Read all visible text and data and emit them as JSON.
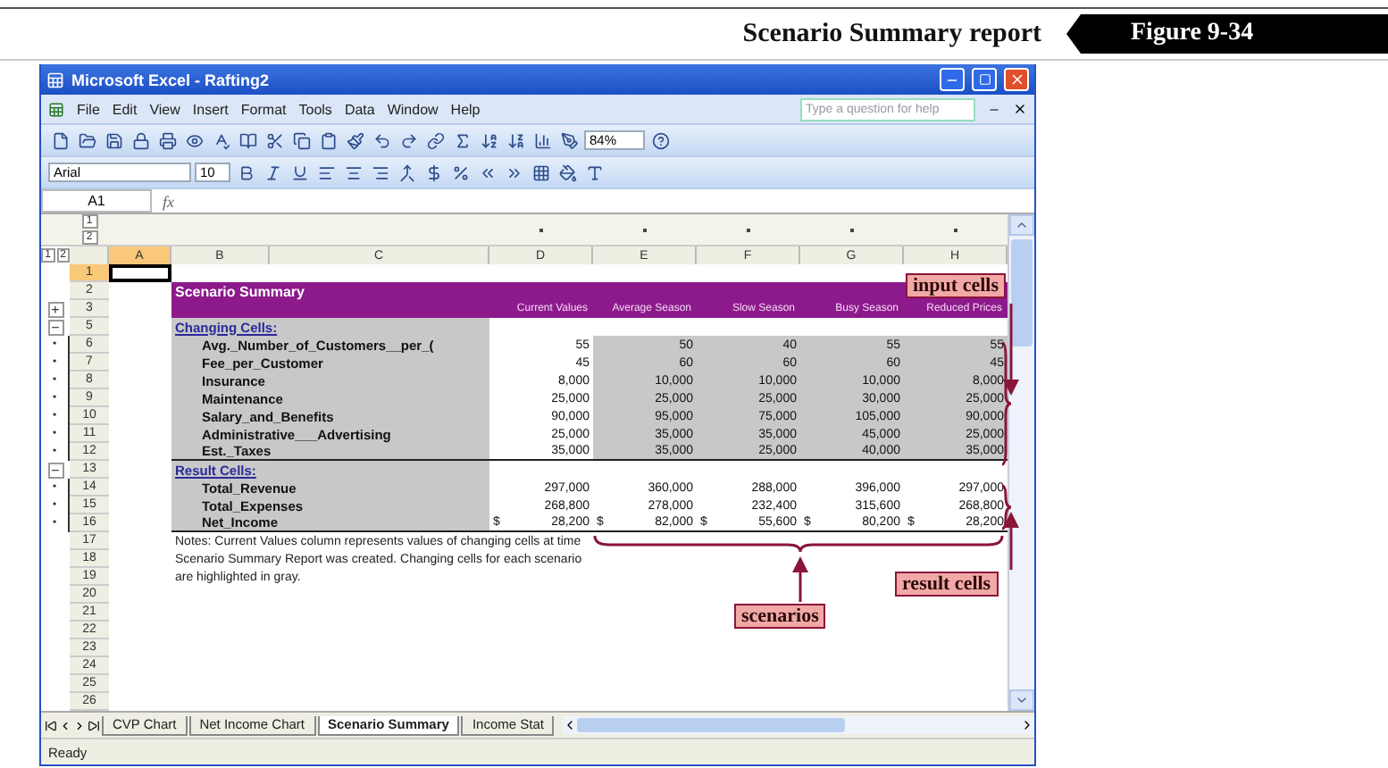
{
  "header": {
    "title": "Scenario Summary report",
    "figure": "Figure 9-34"
  },
  "window": {
    "title": "Microsoft Excel - Rafting2"
  },
  "menu": [
    "File",
    "Edit",
    "View",
    "Insert",
    "Format",
    "Tools",
    "Data",
    "Window",
    "Help"
  ],
  "help_field": {
    "placeholder": "Type a question for help"
  },
  "toolbar": {
    "zoom": "84%"
  },
  "format_toolbar": {
    "font": "Arial",
    "size": "10"
  },
  "formula_bar": {
    "name_box": "A1",
    "function_label": "fx"
  },
  "column_outline_levels": [
    "1",
    "2"
  ],
  "row_outline_levels": [
    "1",
    "2"
  ],
  "columns": [
    {
      "label": "A",
      "selected": true
    },
    {
      "label": "B",
      "selected": false
    },
    {
      "label": "C",
      "selected": false
    },
    {
      "label": "D",
      "selected": false
    },
    {
      "label": "E",
      "selected": false
    },
    {
      "label": "F",
      "selected": false
    },
    {
      "label": "G",
      "selected": false
    },
    {
      "label": "H",
      "selected": false
    }
  ],
  "rows": [
    {
      "number": "1",
      "kind": "blank",
      "selected": true
    },
    {
      "number": "2",
      "kind": "title",
      "selected": false,
      "text": "Scenario Summary"
    },
    {
      "number": "3",
      "kind": "header",
      "selected": false,
      "outline": "+",
      "values": [
        "Current Values",
        "Average Season",
        "Slow Season",
        "Busy Season",
        "Reduced Prices"
      ]
    },
    {
      "number": "5",
      "kind": "section",
      "selected": false,
      "outline": "−",
      "text": "Changing Cells:"
    },
    {
      "number": "6",
      "kind": "data",
      "selected": false,
      "outline": "•",
      "shaded": true,
      "name": "Avg._Number_of_Customers__per_(",
      "values": [
        "55",
        "50",
        "40",
        "55",
        "55"
      ]
    },
    {
      "number": "7",
      "kind": "data",
      "selected": false,
      "outline": "•",
      "shaded": true,
      "name": "Fee_per_Customer",
      "values": [
        "45",
        "60",
        "60",
        "60",
        "45"
      ]
    },
    {
      "number": "8",
      "kind": "data",
      "selected": false,
      "outline": "•",
      "shaded": true,
      "name": "Insurance",
      "values": [
        "8,000",
        "10,000",
        "10,000",
        "10,000",
        "8,000"
      ]
    },
    {
      "number": "9",
      "kind": "data",
      "selected": false,
      "outline": "•",
      "shaded": true,
      "name": "Maintenance",
      "values": [
        "25,000",
        "25,000",
        "25,000",
        "30,000",
        "25,000"
      ]
    },
    {
      "number": "10",
      "kind": "data",
      "selected": false,
      "outline": "•",
      "shaded": true,
      "name": "Salary_and_Benefits",
      "values": [
        "90,000",
        "95,000",
        "75,000",
        "105,000",
        "90,000"
      ]
    },
    {
      "number": "11",
      "kind": "data",
      "selected": false,
      "outline": "•",
      "shaded": true,
      "name": "Administrative___Advertising",
      "values": [
        "25,000",
        "35,000",
        "35,000",
        "45,000",
        "25,000"
      ]
    },
    {
      "number": "12",
      "kind": "data",
      "selected": false,
      "outline": "•",
      "shaded": true,
      "name": "Est._Taxes",
      "values": [
        "35,000",
        "35,000",
        "25,000",
        "40,000",
        "35,000"
      ]
    },
    {
      "number": "13",
      "kind": "section",
      "selected": false,
      "outline": "−",
      "text": "Result Cells:"
    },
    {
      "number": "14",
      "kind": "data",
      "selected": false,
      "outline": "•",
      "shaded": false,
      "name": "Total_Revenue",
      "values": [
        "297,000",
        "360,000",
        "288,000",
        "396,000",
        "297,000"
      ]
    },
    {
      "number": "15",
      "kind": "data",
      "selected": false,
      "outline": "•",
      "shaded": false,
      "name": "Total_Expenses",
      "values": [
        "268,800",
        "278,000",
        "232,400",
        "315,600",
        "268,800"
      ]
    },
    {
      "number": "16",
      "kind": "data",
      "selected": false,
      "outline": "•",
      "shaded": false,
      "name": "Net_Income",
      "symbols": [
        "$",
        "$",
        "$",
        "$",
        "$"
      ],
      "values": [
        "28,200",
        "82,000",
        "55,600",
        "80,200",
        "28,200"
      ]
    },
    {
      "number": "17",
      "kind": "notes",
      "selected": false,
      "text": "Notes:  Current Values column represents values of changing cells at time Scenario Summary Report was created.  Changing cells for each scenario are highlighted in gray."
    },
    {
      "number": "18",
      "kind": "blank",
      "selected": false
    },
    {
      "number": "19",
      "kind": "blank",
      "selected": false
    },
    {
      "number": "20",
      "kind": "blank",
      "selected": false
    },
    {
      "number": "21",
      "kind": "blank",
      "selected": false
    },
    {
      "number": "22",
      "kind": "blank",
      "selected": false
    },
    {
      "number": "23",
      "kind": "blank",
      "selected": false
    },
    {
      "number": "24",
      "kind": "blank",
      "selected": false
    },
    {
      "number": "25",
      "kind": "blank",
      "selected": false
    },
    {
      "number": "26",
      "kind": "blank",
      "selected": false
    }
  ],
  "callouts": {
    "input": "input cells",
    "result": "result cells",
    "scenarios": "scenarios"
  },
  "sheet_tabs": [
    {
      "label": "CVP Chart",
      "selected": false
    },
    {
      "label": "Net Income Chart",
      "selected": false
    },
    {
      "label": "Scenario Summary",
      "selected": true
    },
    {
      "label": "Income Stat",
      "selected": false
    }
  ],
  "status_bar": "Ready"
}
